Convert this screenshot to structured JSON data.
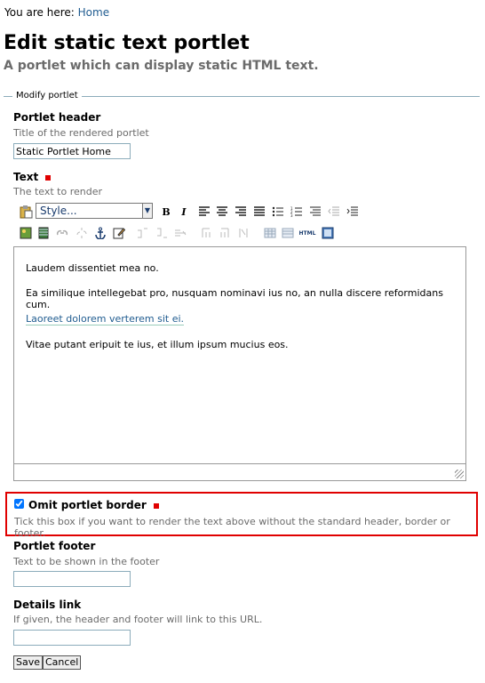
{
  "breadcrumb": {
    "prefix": "You are here:",
    "home": "Home"
  },
  "page": {
    "title": "Edit static text portlet",
    "description": "A portlet which can display static HTML text."
  },
  "form": {
    "legend": "Modify portlet",
    "header": {
      "label": "Portlet header",
      "help": "Title of the rendered portlet",
      "value": "Static Portlet Home"
    },
    "text": {
      "label": "Text",
      "help": "The text to render",
      "style_placeholder": "Style...",
      "content": [
        "Laudem dissentiet mea no.",
        "Ea similique intellegebat pro, nusquam nominavi ius no, an nulla discere reformidans cum.",
        "Laoreet dolorem verterem sit ei.",
        "Vitae putant eripuit te ius, et illum ipsum mucius eos."
      ]
    },
    "omit_border": {
      "label": "Omit portlet border",
      "help": "Tick this box if you want to render the text above without the standard header, border or footer.",
      "checked": true
    },
    "footer": {
      "label": "Portlet footer",
      "help": "Text to be shown in the footer",
      "value": ""
    },
    "details_link": {
      "label": "Details link",
      "help": "If given, the header and footer will link to this URL.",
      "value": ""
    },
    "buttons": {
      "save": "Save",
      "cancel": "Cancel"
    }
  },
  "toolbar": {
    "bold": "B",
    "italic": "I",
    "html": "HTML"
  },
  "colors": {
    "link": "#205c90",
    "required": "#e00000",
    "legend_line": "#8cacbb"
  }
}
